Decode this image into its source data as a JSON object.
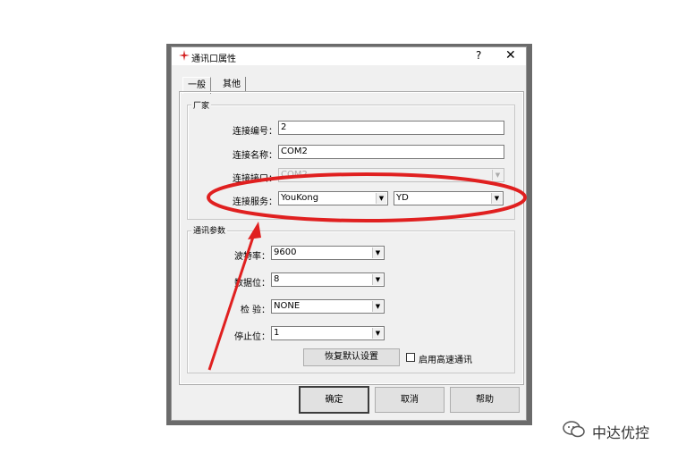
{
  "dialog": {
    "title": "通讯口属性",
    "help_glyph": "?",
    "close_glyph": "✕"
  },
  "tabs": [
    {
      "label": "一般"
    },
    {
      "label": "其他"
    }
  ],
  "vendor_group": {
    "title": "厂家",
    "conn_no": {
      "label": "连接编号：",
      "value": "2"
    },
    "conn_name": {
      "label": "连接名称：",
      "value": "COM2"
    },
    "conn_port": {
      "label": "连接接口：",
      "value": "COM2"
    },
    "conn_service": {
      "label": "连接服务：",
      "value1": "YouKong",
      "value2": "YD"
    }
  },
  "comm_group": {
    "title": "通讯参数",
    "baud": {
      "label": "波特率：",
      "value": "9600"
    },
    "databits": {
      "label": "数据位：",
      "value": "8"
    },
    "parity": {
      "label": "检 验：",
      "value": "NONE"
    },
    "stopbits": {
      "label": "停止位：",
      "value": "1"
    },
    "restore_btn": "恢复默认设置",
    "highspeed": "启用高速通讯"
  },
  "buttons": {
    "ok": "确定",
    "cancel": "取消",
    "help": "帮助"
  },
  "watermark": {
    "text": "中达优控"
  },
  "colors": {
    "annotation": "#e02020"
  }
}
